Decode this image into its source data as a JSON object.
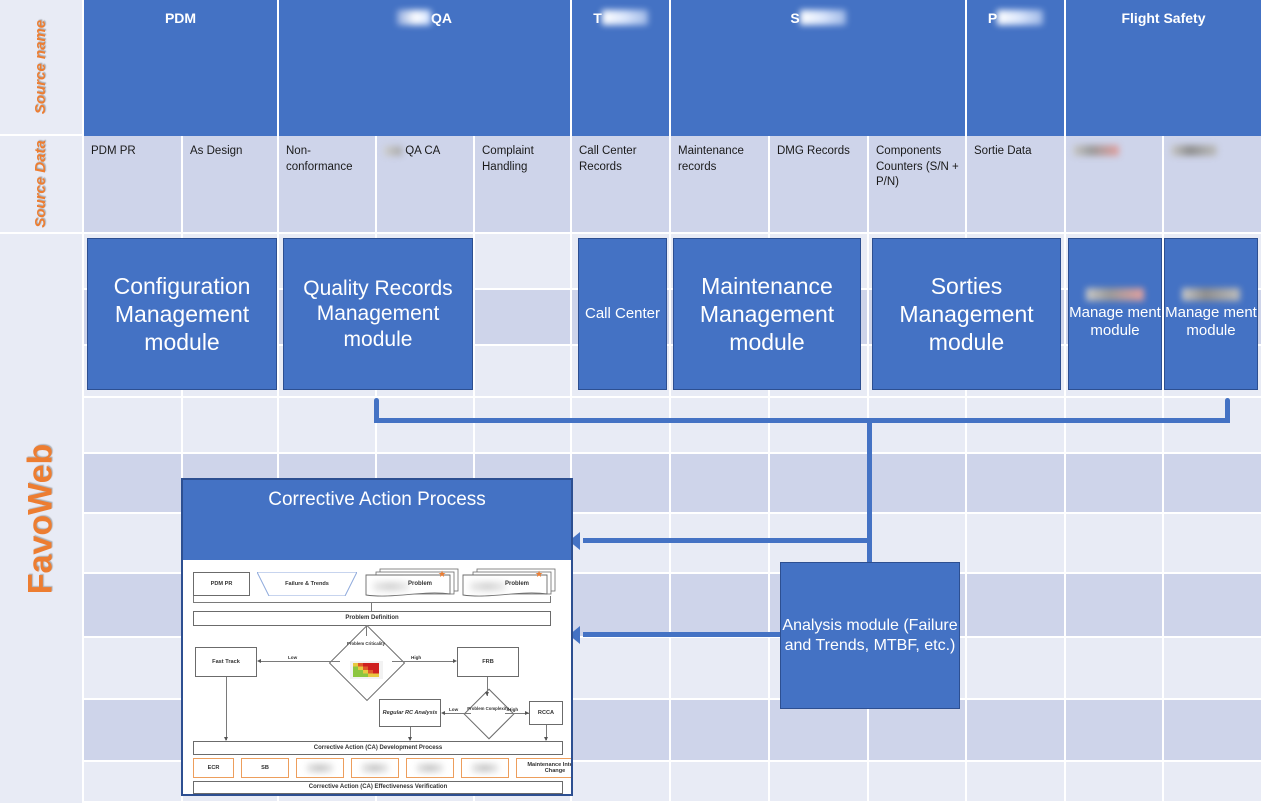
{
  "row_labels": {
    "source_name": "Source name",
    "source_data": "Source Data",
    "product": "FavoWeb"
  },
  "accent_colors": {
    "blue": "#4472C4",
    "orange": "#ED7D31",
    "band_light": "#E8EBF5",
    "band_dark": "#CED4EA"
  },
  "source_names": [
    {
      "label": "PDM",
      "redacted": false,
      "redacted_prefix": ""
    },
    {
      "label": "QA",
      "redacted": true,
      "redacted_prefix": "redacted"
    },
    {
      "label": "T",
      "redacted": true,
      "redacted_prefix": ""
    },
    {
      "label": "S",
      "redacted": true,
      "redacted_prefix": ""
    },
    {
      "label": "P",
      "redacted": true,
      "redacted_prefix": ""
    },
    {
      "label": "Flight Safety",
      "redacted": false,
      "redacted_prefix": ""
    }
  ],
  "source_data": [
    {
      "label": "PDM PR",
      "redacted": false
    },
    {
      "label": "As Design",
      "redacted": false
    },
    {
      "label": "Non-conformance",
      "redacted": false
    },
    {
      "label": "QA CA",
      "redacted": true
    },
    {
      "label": "Complaint Handling",
      "redacted": false
    },
    {
      "label": "Call Center Records",
      "redacted": false
    },
    {
      "label": "Maintenance records",
      "redacted": false
    },
    {
      "label": "DMG Records",
      "redacted": false
    },
    {
      "label": "Components Counters (S/N + P/N)",
      "redacted": false
    },
    {
      "label": "Sortie Data",
      "redacted": false
    },
    {
      "label": "",
      "redacted": true
    },
    {
      "label": "",
      "redacted": true
    }
  ],
  "modules": [
    {
      "label": "Configuration Management module",
      "redacted_prefix": false
    },
    {
      "label": "Quality Records Management module",
      "redacted_prefix": false
    },
    {
      "label": "Call Center",
      "redacted_prefix": false
    },
    {
      "label": "Maintenance Management module",
      "redacted_prefix": false
    },
    {
      "label": "Sorties Management module",
      "redacted_prefix": false
    },
    {
      "label": "Manage ment module",
      "redacted_prefix": true
    },
    {
      "label": "Manage ment module",
      "redacted_prefix": true
    }
  ],
  "analysis_module": {
    "label": "Analysis module (Failure and Trends, MTBF, etc.)"
  },
  "cap_panel": {
    "title": "Corrective Action Process",
    "inputs": [
      {
        "label": "PDM PR",
        "shape": "box"
      },
      {
        "label": "Failure & Trends",
        "shape": "trapezoid"
      },
      {
        "label": "Problem",
        "shape": "doc-stack",
        "redacted": true,
        "starred": true
      },
      {
        "label": "Problem",
        "shape": "doc-stack",
        "redacted": true,
        "starred": true
      }
    ],
    "problem_definition": "Problem Definition",
    "criticality_decision": "Problem Criticality",
    "criticality_low": "Low",
    "criticality_high": "High",
    "fast_track": "Fast Track",
    "frb": "FRB",
    "complexity_decision": "Problem Complexity",
    "complexity_low": "Low",
    "complexity_high": "High",
    "regular_rc": "Regular RC Analysis",
    "rcca": "RCCA",
    "development_process": "Corrective Action (CA) Development Process",
    "ca_items": [
      {
        "label": "ECR",
        "redacted": false
      },
      {
        "label": "SB",
        "redacted": false
      },
      {
        "label": "",
        "redacted": true
      },
      {
        "label": "",
        "redacted": true
      },
      {
        "label": "",
        "redacted": true
      },
      {
        "label": "",
        "redacted": true
      },
      {
        "label": "Maintenance Interval Change",
        "redacted": false
      }
    ],
    "effectiveness_verification": "Corrective Action (CA) Effectiveness Verification"
  }
}
